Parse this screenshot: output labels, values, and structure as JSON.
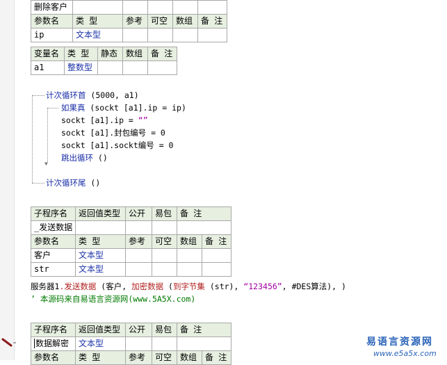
{
  "table_top": {
    "row1": "删除客户",
    "headers": [
      "参数名",
      "类 型",
      "参考",
      "可空",
      "数组",
      "备 注"
    ],
    "param": {
      "name": "ip",
      "type": "文本型"
    }
  },
  "var_table": {
    "headers": [
      "变量名",
      "类 型",
      "静态",
      "数组",
      "备 注"
    ],
    "row": {
      "name": "a1",
      "type": "整数型"
    }
  },
  "code": {
    "loop_head_kw": "计次循环首",
    "loop_head_args": " (5000, a1)",
    "if_kw": "如果真",
    "if_args": " (sockt [a1].ip = ip)",
    "line1": "sockt [a1].ip = ",
    "line1_str": "“”",
    "line2": "sockt [a1].封包编号 = 0",
    "line3": "sockt [a1].sockt编号 = 0",
    "break_kw": "跳出循环",
    "break_args": " ()",
    "loop_tail_kw": "计次循环尾",
    "loop_tail_args": " ()"
  },
  "table_send": {
    "headers": [
      "子程序名",
      "返回值类型",
      "公开",
      "易包",
      "备 注"
    ],
    "name": "_发送数据",
    "param_headers": [
      "参数名",
      "类 型",
      "参考",
      "可空",
      "数组",
      "备 注"
    ],
    "params": [
      {
        "name": "客户",
        "type": "文本型"
      },
      {
        "name": "str",
        "type": "文本型"
      }
    ]
  },
  "send_line": {
    "obj": "服务器1",
    "method": ".发送数据",
    "p1": " (客户, ",
    "fn1": "加密数据",
    "p2": " (",
    "fn2": "到字节集",
    "p3": " (str), ",
    "str": "“123456”",
    "p4": ", #DES算法), )"
  },
  "comment": "’ 本源码来自易语言资源网(www.5A5X.com)",
  "table_decrypt": {
    "headers": [
      "子程序名",
      "返回值类型",
      "公开",
      "易包",
      "备 注"
    ],
    "name": "数据解密",
    "type": "文本型",
    "param_headers": [
      "参数名",
      "类 型",
      "参考",
      "可空",
      "数组",
      "备 注"
    ]
  },
  "watermark": {
    "cn": "易语言资源网",
    "url": "www.e5a5x.com"
  }
}
